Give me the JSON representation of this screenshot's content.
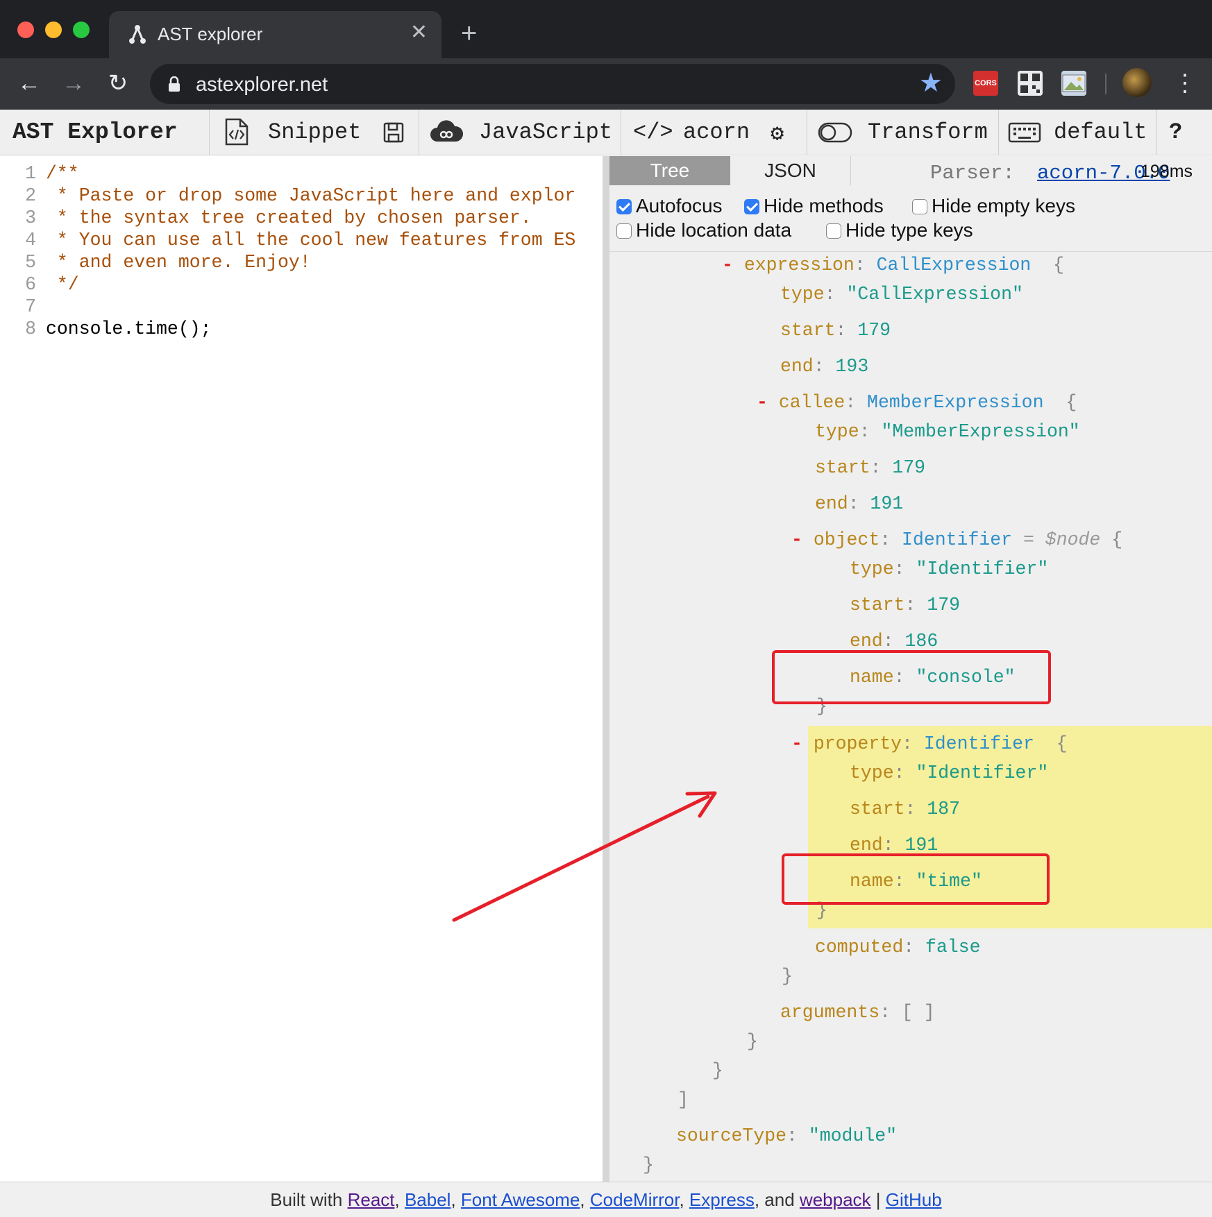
{
  "browser": {
    "tab_title": "AST explorer",
    "url": "astexplorer.net",
    "ext_cors_label": "CORS",
    "icons": [
      "back-icon",
      "forward-icon",
      "reload-icon",
      "lock-icon",
      "star-icon",
      "close-icon",
      "plus-icon",
      "more-icon"
    ]
  },
  "header": {
    "title": "AST Explorer",
    "snippet": "Snippet",
    "language": "JavaScript",
    "parser": "acorn",
    "transform": "Transform",
    "keymap": "default",
    "help": "?"
  },
  "editor": {
    "lines": [
      {
        "num": "1",
        "text": "/**"
      },
      {
        "num": "2",
        "text": " * Paste or drop some JavaScript here and explor"
      },
      {
        "num": "3",
        "text": " * the syntax tree created by chosen parser."
      },
      {
        "num": "4",
        "text": " * You can use all the cool new features from ES"
      },
      {
        "num": "5",
        "text": " * and even more. Enjoy!"
      },
      {
        "num": "6",
        "text": " */"
      },
      {
        "num": "7",
        "text": ""
      },
      {
        "num": "8",
        "text": "console.time();"
      }
    ]
  },
  "output": {
    "tabs": [
      "Tree",
      "JSON"
    ],
    "parser_label": "Parser:",
    "parser_link": "acorn-7.0.0",
    "timing": "198ms",
    "options": [
      {
        "label": "Autofocus",
        "checked": true
      },
      {
        "label": "Hide methods",
        "checked": true
      },
      {
        "label": "Hide empty keys",
        "checked": false
      },
      {
        "label": "Hide location data",
        "checked": false
      },
      {
        "label": "Hide type keys",
        "checked": false
      }
    ],
    "tree": {
      "expression": {
        "key": "expression",
        "type": "CallExpression",
        "type_val": "\"CallExpression\"",
        "start": "179",
        "end": "193"
      },
      "callee": {
        "key": "callee",
        "type": "MemberExpression",
        "type_val": "\"MemberExpression\"",
        "start": "179",
        "end": "191"
      },
      "object": {
        "key": "object",
        "type": "Identifier",
        "node_ref": "= $node",
        "type_val": "\"Identifier\"",
        "start": "179",
        "end": "186",
        "name": "\"console\""
      },
      "property": {
        "key": "property",
        "type": "Identifier",
        "type_val": "\"Identifier\"",
        "start": "187",
        "end": "191",
        "name": "\"time\""
      },
      "computed": {
        "key": "computed",
        "value": "false"
      },
      "arguments": {
        "key": "arguments",
        "value": "[ ]"
      },
      "sourceType": {
        "key": "sourceType",
        "value": "\"module\""
      }
    },
    "labels": {
      "type": "type",
      "start": "start",
      "end": "end",
      "name": "name",
      "minus": "-",
      "colon": ":",
      "open": "{",
      "close": "}",
      "close_bracket": "]"
    }
  },
  "footer": {
    "prefix": "Built with",
    "links": [
      "React",
      "Babel",
      "Font Awesome",
      "CodeMirror",
      "Express",
      "webpack",
      "GitHub"
    ],
    "and": "and",
    "sep": "|"
  },
  "colors": {
    "annotation_red": "#e6202a",
    "highlight_yellow": "#f6ef9c",
    "comment": "#a7500b",
    "key": "#b8861b",
    "type": "#2f8fcb",
    "string": "#1a9a8b"
  }
}
